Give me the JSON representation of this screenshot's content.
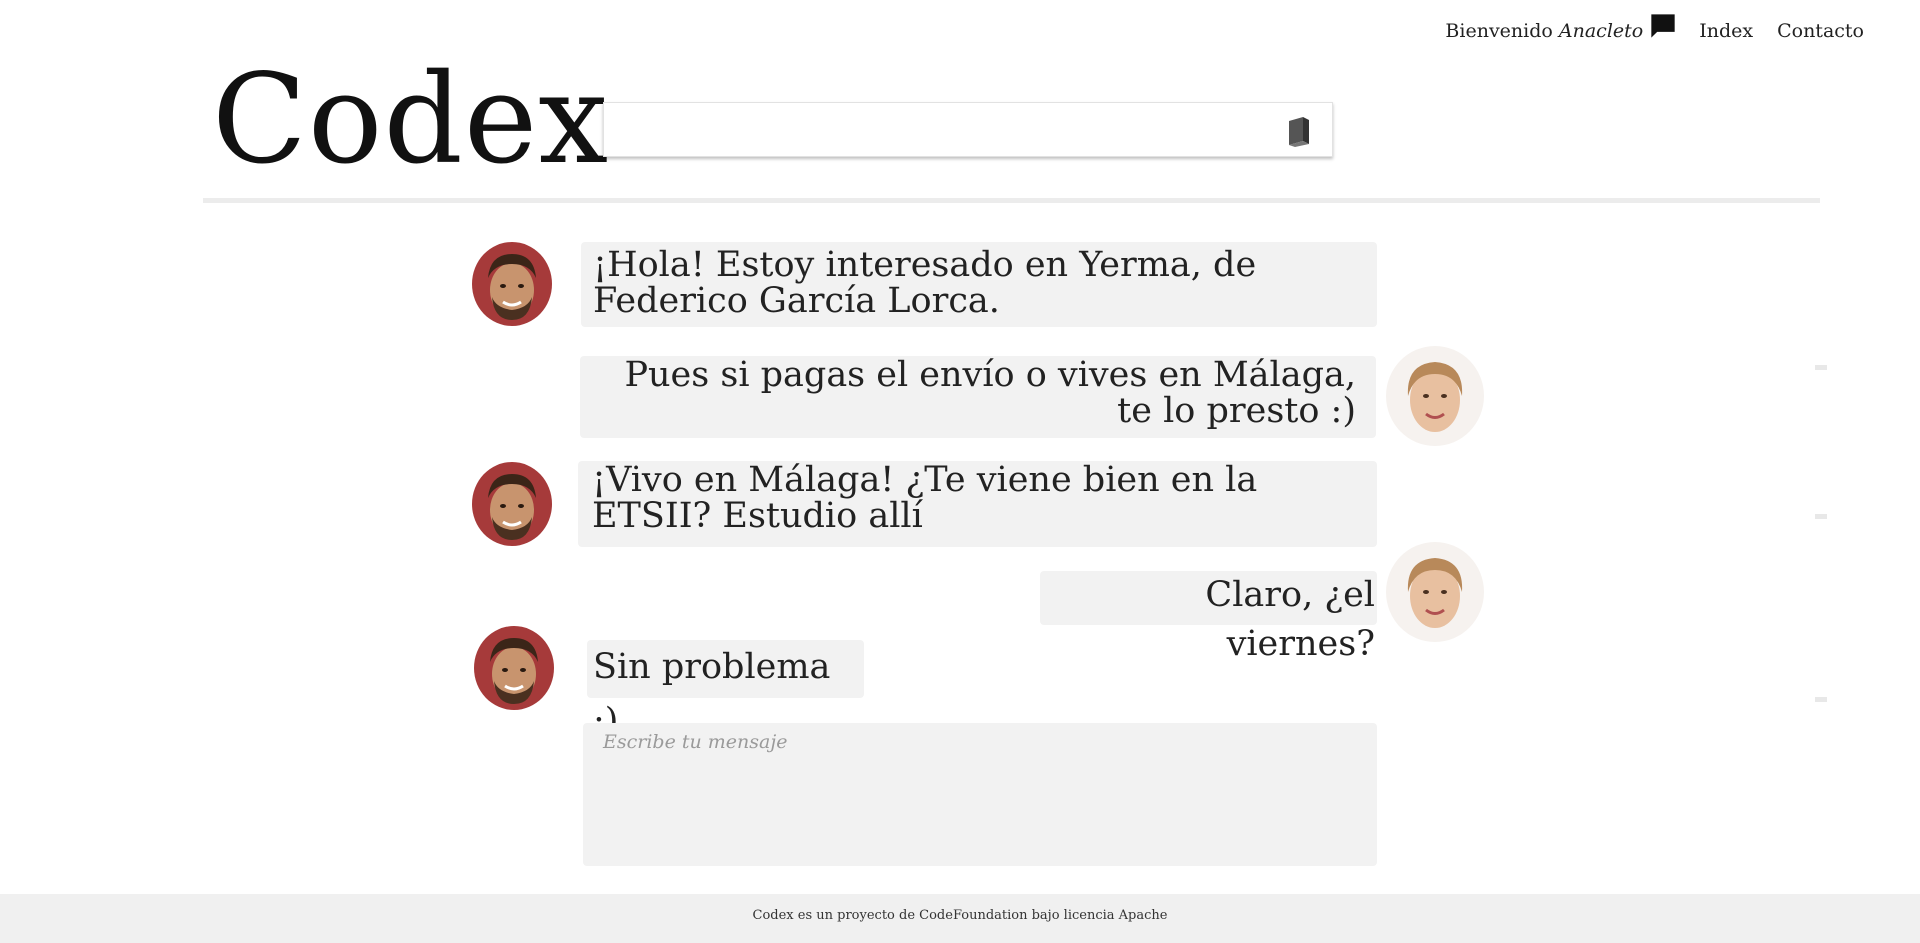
{
  "nav": {
    "welcome_prefix": "Bienvenido",
    "user_name": "Anacleto",
    "links": [
      "Index",
      "Contacto"
    ]
  },
  "brand": "Codex",
  "search": {
    "placeholder": ""
  },
  "messages": [
    {
      "sender": "user",
      "text": "¡Hola! Estoy interesado en Yerma, de Federico García Lorca."
    },
    {
      "sender": "lender",
      "text": "Pues si pagas el envío o vives en Málaga, te lo presto :)"
    },
    {
      "sender": "user",
      "text": "¡Vivo en Málaga! ¿Te viene bien en la ETSII? Estudio allí"
    },
    {
      "sender": "lender",
      "text": "Claro, ¿el viernes?"
    },
    {
      "sender": "user",
      "text": "Sin problema :)"
    }
  ],
  "compose": {
    "placeholder": "Escribe tu mensaje"
  },
  "footer": "Codex es un proyecto de CodeFoundation bajo licencia Apache",
  "colors": {
    "bubble": "#f2f2f2",
    "footer_bg": "#f0f0f0",
    "text": "#222222"
  }
}
